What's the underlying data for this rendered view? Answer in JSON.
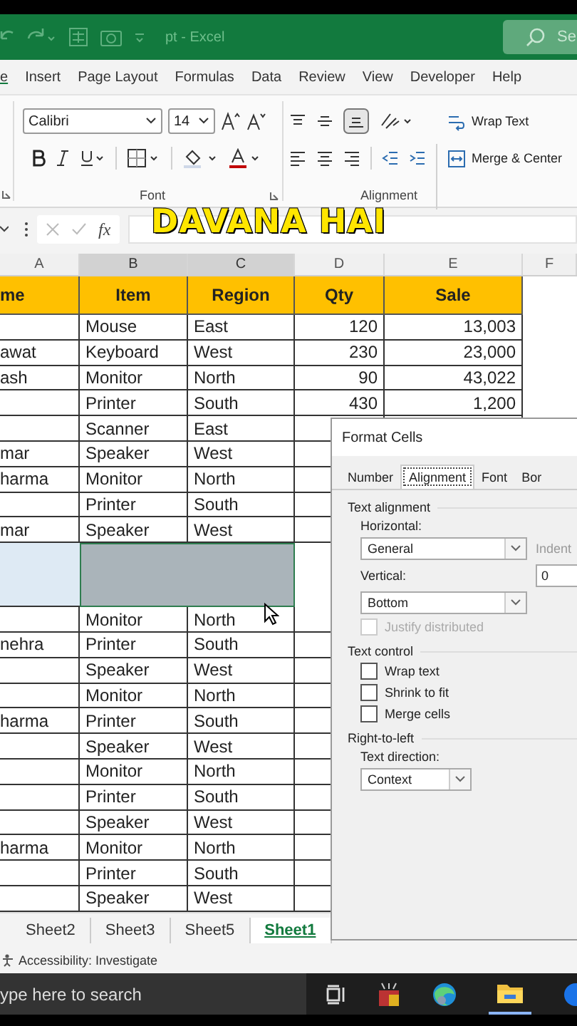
{
  "title_bar": {
    "title": "pt - Excel",
    "search": {
      "placeholder": "Se"
    }
  },
  "ribbon_tabs": [
    {
      "label": "e",
      "selected": true
    },
    {
      "label": "Insert",
      "selected": false
    },
    {
      "label": "Page Layout",
      "selected": false
    },
    {
      "label": "Formulas",
      "selected": false
    },
    {
      "label": "Data",
      "selected": false
    },
    {
      "label": "Review",
      "selected": false
    },
    {
      "label": "View",
      "selected": false
    },
    {
      "label": "Developer",
      "selected": false
    },
    {
      "label": "Help",
      "selected": false
    }
  ],
  "font_group": {
    "font_name": "Calibri",
    "font_size": "14",
    "label": "Font"
  },
  "alignment_group": {
    "wrap_text": "Wrap Text",
    "merge": "Merge & Center",
    "label": "Alignment"
  },
  "formula_bar": {
    "function_label": "fx"
  },
  "caption": "DAVANA HAI",
  "columns": [
    "A",
    "B",
    "C",
    "D",
    "E",
    "F"
  ],
  "header_row": [
    "me",
    "Item",
    "Region",
    "Qty",
    "Sale"
  ],
  "rows": [
    {
      "item": "Mouse",
      "region": "East",
      "qty": "120",
      "sale": "13,003",
      "selected": false
    },
    {
      "name": "awat",
      "item": "Keyboard",
      "region": "West",
      "qty": "230",
      "sale": "23,000",
      "selected": false
    },
    {
      "name": "ash",
      "item": "Monitor",
      "region": "North",
      "qty": "90",
      "sale": "43,022",
      "selected": false
    },
    {
      "item": "Printer",
      "region": "South",
      "qty": "430",
      "sale": "1,200",
      "selected": false
    },
    {
      "item": "Scanner",
      "region": "East",
      "selected": false
    },
    {
      "name": "mar",
      "item": "Speaker",
      "region": "West",
      "selected": false
    },
    {
      "name": "harma",
      "item": "Monitor",
      "region": "North",
      "selected": false
    },
    {
      "item": "Printer",
      "region": "South",
      "selected": false
    },
    {
      "name": "mar",
      "item": "Speaker",
      "region": "West",
      "selected": false
    },
    {
      "selected": true
    },
    {
      "item": "Monitor",
      "region": "North",
      "selected": false
    },
    {
      "name": "nehra",
      "item": "Printer",
      "region": "South",
      "selected": false
    },
    {
      "item": "Speaker",
      "region": "West",
      "selected": false
    },
    {
      "item": "Monitor",
      "region": "North",
      "selected": false
    },
    {
      "name": "harma",
      "item": "Printer",
      "region": "South",
      "selected": false
    },
    {
      "item": "Speaker",
      "region": "West",
      "selected": false
    },
    {
      "item": "Monitor",
      "region": "North",
      "selected": false
    },
    {
      "item": "Printer",
      "region": "South",
      "selected": false
    },
    {
      "item": "Speaker",
      "region": "West",
      "selected": false
    },
    {
      "name": "harma",
      "item": "Monitor",
      "region": "North",
      "selected": false
    },
    {
      "item": "Printer",
      "region": "South",
      "selected": false
    },
    {
      "item": "Speaker",
      "region": "West",
      "selected": false
    }
  ],
  "sheet_tabs": [
    {
      "label": "Sheet2",
      "selected": false
    },
    {
      "label": "Sheet3",
      "selected": false
    },
    {
      "label": "Sheet5",
      "selected": false
    },
    {
      "label": "Sheet1",
      "selected": true
    }
  ],
  "status_bar": {
    "accessibility": "Accessibility: Investigate"
  },
  "taskbar": {
    "search": {
      "placeholder": "ype here to search"
    }
  },
  "dialog": {
    "title": "Format Cells",
    "tabs": [
      {
        "label": "Number",
        "selected": false
      },
      {
        "label": "Alignment",
        "selected": true
      },
      {
        "label": "Font",
        "selected": false
      },
      {
        "label": "Bor",
        "selected": false
      }
    ],
    "text_alignment": {
      "heading": "Text alignment",
      "horizontal_label": "Horizontal:",
      "horizontal_value": "General",
      "indent_label": "Indent",
      "indent_value": "0",
      "vertical_label": "Vertical:",
      "vertical_value": "Bottom",
      "justify_distributed": {
        "label": "Justify distributed",
        "checked": false,
        "disabled": true
      }
    },
    "text_control": {
      "heading": "Text control",
      "options": [
        {
          "label": "Wrap text",
          "checked": false
        },
        {
          "label": "Shrink to fit",
          "checked": false
        },
        {
          "label": "Merge cells",
          "checked": false
        }
      ]
    },
    "right_to_left": {
      "heading": "Right-to-left",
      "direction_label": "Text direction:",
      "direction_value": "Context"
    }
  }
}
